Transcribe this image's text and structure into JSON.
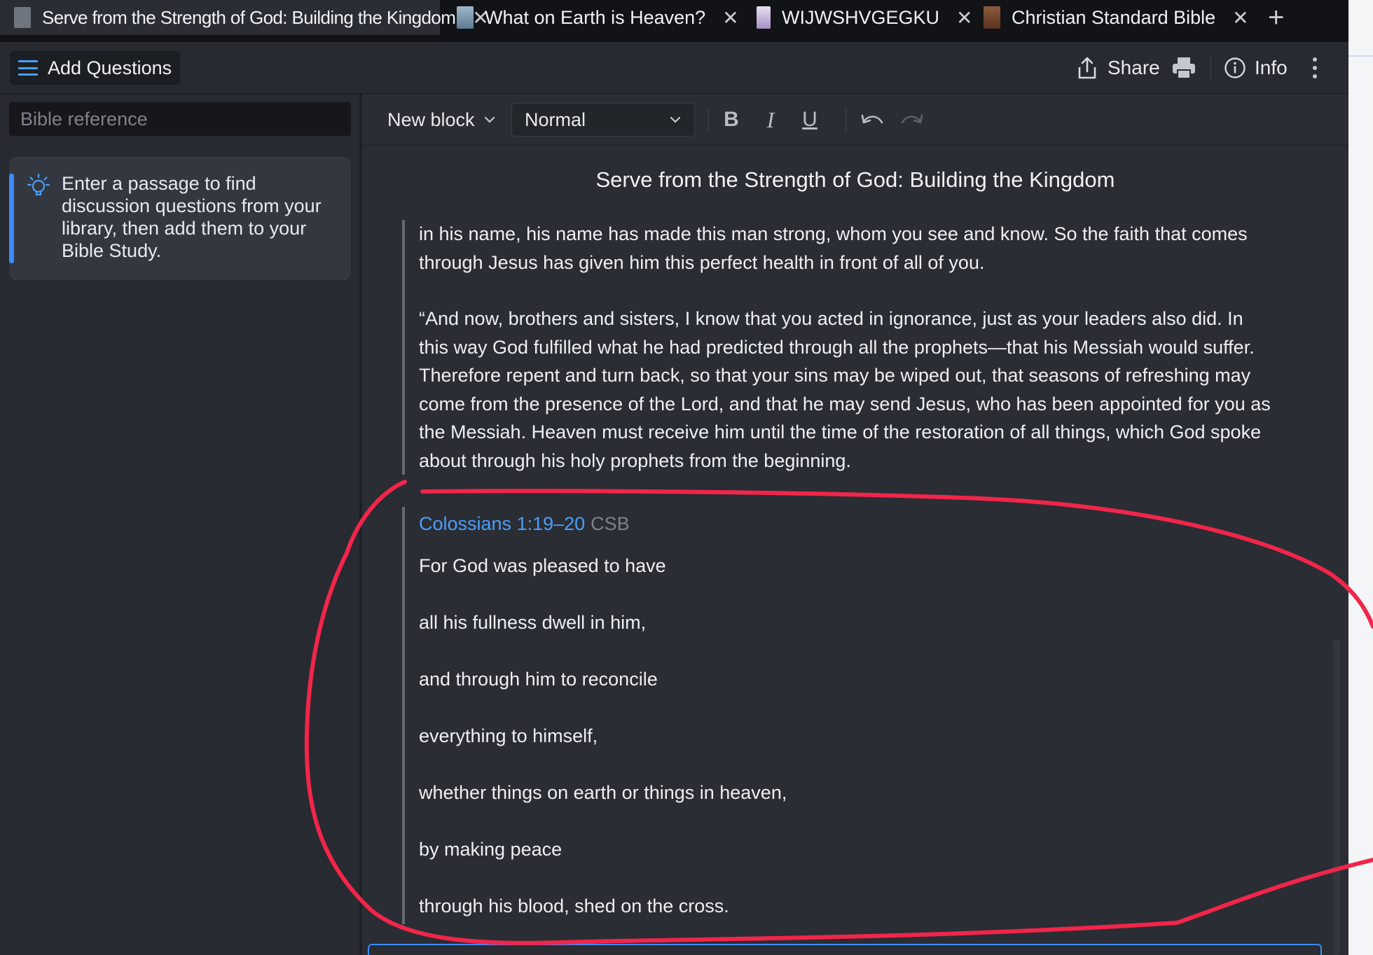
{
  "tabs": [
    {
      "title": "Serve from the Strength of God: Building the Kingdom",
      "icon": "document-icon",
      "active": true
    },
    {
      "title": "What on Earth is Heaven?",
      "icon": "book-cover-icon",
      "active": false
    },
    {
      "title": "WIJWSHVGEGKU",
      "icon": "book-cover-icon",
      "active": false
    },
    {
      "title": "Christian Standard Bible",
      "icon": "book-cover-icon",
      "active": false
    }
  ],
  "toolbar": {
    "add_questions_label": "Add Questions",
    "share_label": "Share",
    "info_label": "Info"
  },
  "left_panel": {
    "search_placeholder": "Bible reference",
    "tip_text": "Enter a passage to find discussion questions from your library, then add them to your Bible Study."
  },
  "format_bar": {
    "new_block_label": "New block",
    "style_value": "Normal",
    "bold_label": "B",
    "italic_label": "I",
    "underline_label": "U"
  },
  "document": {
    "title": "Serve from the Strength of God: Building the Kingdom",
    "quote1_paragraphs": [
      "in his name, his name has made this man strong, whom you see and know. So the faith that comes through Jesus has given him this perfect health in front of all of you.",
      "“And now, brothers and sisters, I know that you acted in ignorance, just as your leaders also did. In this way God fulfilled what he had predicted through all the prophets—that his Messiah would suffer. Therefore repent and turn back, so that your sins may be wiped out, that seasons of refreshing may come from the presence of the Lord, and that he may send Jesus, who has been appointed for you as the Messiah. Heaven must receive him until the time of the restoration of all things, which God spoke about through his holy prophets from the beginning."
    ],
    "passage": {
      "reference": "Colossians 1:19–20",
      "version": "CSB",
      "lines": [
        "For God was pleased to have",
        "all his fullness dwell in him,",
        "and through him to reconcile",
        "everything to himself,",
        "whether things on earth or things in heaven,",
        "by making peace",
        "through his blood, shed on the cross."
      ]
    }
  },
  "colors": {
    "accent": "#4a9eff",
    "annotation": "#f2254a"
  }
}
